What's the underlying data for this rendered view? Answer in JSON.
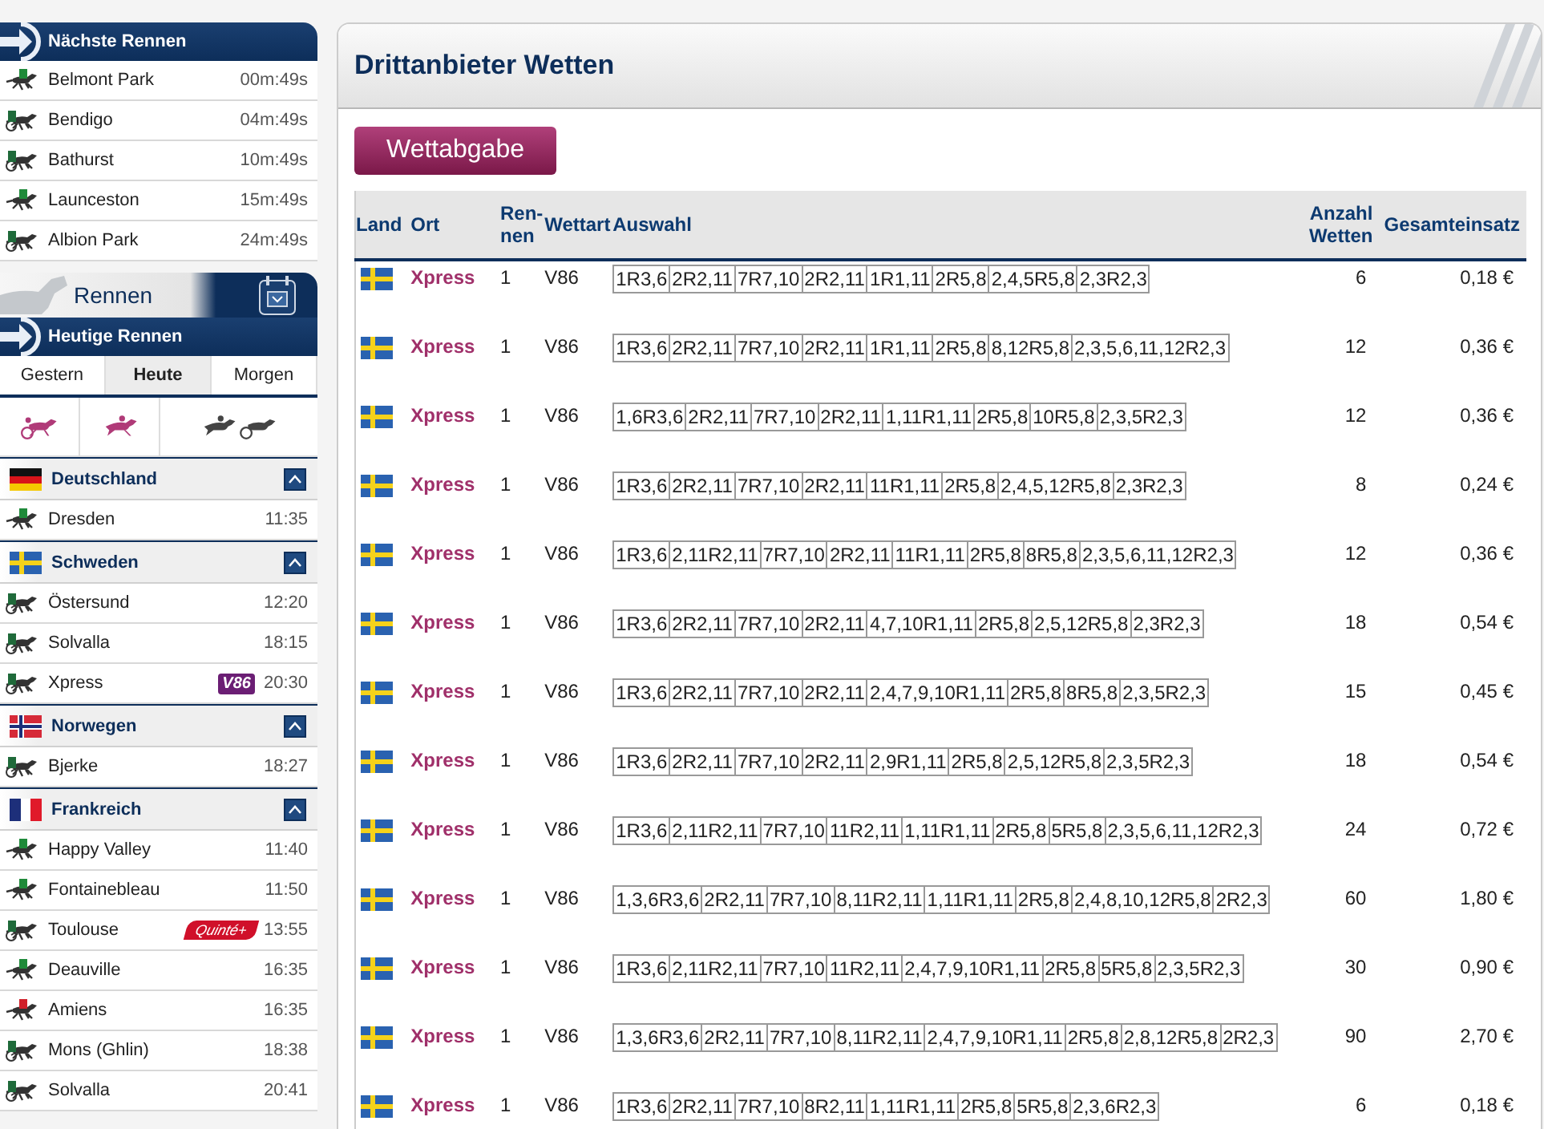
{
  "sidebar": {
    "next_races": {
      "title": "Nächste Rennen",
      "items": [
        {
          "name": "Belmont Park",
          "time": "00m:49s",
          "kind": "gallop",
          "color": "#1f8a3a"
        },
        {
          "name": "Bendigo",
          "time": "04m:49s",
          "kind": "trot",
          "color": "#1f6a3a"
        },
        {
          "name": "Bathurst",
          "time": "10m:49s",
          "kind": "trot",
          "color": "#1f6a3a"
        },
        {
          "name": "Launceston",
          "time": "15m:49s",
          "kind": "gallop",
          "color": "#1f8a3a"
        },
        {
          "name": "Albion Park",
          "time": "24m:49s",
          "kind": "trot",
          "color": "#1f6a3a"
        }
      ]
    },
    "races_header": "Rennen",
    "today": {
      "title": "Heutige Rennen",
      "tabs": [
        {
          "label": "Gestern",
          "selected": false
        },
        {
          "label": "Heute",
          "selected": true
        },
        {
          "label": "Morgen",
          "selected": false
        }
      ],
      "countries": [
        {
          "name": "Deutschland",
          "kind": "de",
          "expanded": true,
          "races": [
            {
              "name": "Dresden",
              "time": "11:35",
              "kind": "gallop",
              "color": "#1f8a3a"
            }
          ]
        },
        {
          "name": "Schweden",
          "kind": "se",
          "expanded": true,
          "races": [
            {
              "name": "Östersund",
              "time": "12:20",
              "kind": "trot",
              "color": "#1f6a3a"
            },
            {
              "name": "Solvalla",
              "time": "18:15",
              "kind": "trot",
              "color": "#1f6a3a"
            },
            {
              "name": "Xpress",
              "time": "20:30",
              "kind": "trot",
              "color": "#1f6a3a",
              "badge": {
                "text": "V86",
                "kind": "v86"
              }
            }
          ]
        },
        {
          "name": "Norwegen",
          "kind": "no",
          "expanded": true,
          "races": [
            {
              "name": "Bjerke",
              "time": "18:27",
              "kind": "trot",
              "color": "#1f6a3a"
            }
          ]
        },
        {
          "name": "Frankreich",
          "kind": "fr",
          "expanded": true,
          "races": [
            {
              "name": "Happy Valley",
              "time": "11:40",
              "kind": "gallop",
              "color": "#1f8a3a"
            },
            {
              "name": "Fontainebleau",
              "time": "11:50",
              "kind": "gallop",
              "color": "#1f8a3a"
            },
            {
              "name": "Toulouse",
              "time": "13:55",
              "kind": "trot",
              "color": "#1f6a3a",
              "badge": {
                "text": "Quinté+",
                "kind": "quinte"
              }
            },
            {
              "name": "Deauville",
              "time": "16:35",
              "kind": "gallop",
              "color": "#1f8a3a"
            },
            {
              "name": "Amiens",
              "time": "16:35",
              "kind": "gallop",
              "color": "#d0202a"
            },
            {
              "name": "Mons (Ghlin)",
              "time": "18:38",
              "kind": "trot",
              "color": "#1f6a3a"
            },
            {
              "name": "Solvalla",
              "time": "20:41",
              "kind": "trot",
              "color": "#1f6a3a"
            }
          ]
        }
      ]
    }
  },
  "main": {
    "title": "Drittanbieter Wetten",
    "submit_button": "Wettabgabe",
    "table": {
      "columns": [
        "Land",
        "Ort",
        "Ren-\nnen",
        "Wettart",
        "Auswahl",
        "Anzahl\nWetten",
        "Gesamteinsatz"
      ],
      "rows": [
        {
          "kind": "se",
          "ort": "Xpress",
          "rennen": "1",
          "wettart": "V86",
          "auswahl": [
            "1R3,6",
            "2R2,11",
            "7R7,10",
            "2R2,11",
            "1R1,11",
            "2R5,8",
            "2,4,5R5,8",
            "2,3R2,3"
          ],
          "anzahl": "6",
          "einsatz": "0,18 €"
        },
        {
          "kind": "se",
          "ort": "Xpress",
          "rennen": "1",
          "wettart": "V86",
          "auswahl": [
            "1R3,6",
            "2R2,11",
            "7R7,10",
            "2R2,11",
            "1R1,11",
            "2R5,8",
            "8,12R5,8",
            "2,3,5,6,11,12R2,3"
          ],
          "anzahl": "12",
          "einsatz": "0,36 €"
        },
        {
          "kind": "se",
          "ort": "Xpress",
          "rennen": "1",
          "wettart": "V86",
          "auswahl": [
            "1,6R3,6",
            "2R2,11",
            "7R7,10",
            "2R2,11",
            "1,11R1,11",
            "2R5,8",
            "10R5,8",
            "2,3,5R2,3"
          ],
          "anzahl": "12",
          "einsatz": "0,36 €"
        },
        {
          "kind": "se",
          "ort": "Xpress",
          "rennen": "1",
          "wettart": "V86",
          "auswahl": [
            "1R3,6",
            "2R2,11",
            "7R7,10",
            "2R2,11",
            "11R1,11",
            "2R5,8",
            "2,4,5,12R5,8",
            "2,3R2,3"
          ],
          "anzahl": "8",
          "einsatz": "0,24 €"
        },
        {
          "kind": "se",
          "ort": "Xpress",
          "rennen": "1",
          "wettart": "V86",
          "auswahl": [
            "1R3,6",
            "2,11R2,11",
            "7R7,10",
            "2R2,11",
            "11R1,11",
            "2R5,8",
            "8R5,8",
            "2,3,5,6,11,12R2,3"
          ],
          "anzahl": "12",
          "einsatz": "0,36 €"
        },
        {
          "kind": "se",
          "ort": "Xpress",
          "rennen": "1",
          "wettart": "V86",
          "auswahl": [
            "1R3,6",
            "2R2,11",
            "7R7,10",
            "2R2,11",
            "4,7,10R1,11",
            "2R5,8",
            "2,5,12R5,8",
            "2,3R2,3"
          ],
          "anzahl": "18",
          "einsatz": "0,54 €"
        },
        {
          "kind": "se",
          "ort": "Xpress",
          "rennen": "1",
          "wettart": "V86",
          "auswahl": [
            "1R3,6",
            "2R2,11",
            "7R7,10",
            "2R2,11",
            "2,4,7,9,10R1,11",
            "2R5,8",
            "8R5,8",
            "2,3,5R2,3"
          ],
          "anzahl": "15",
          "einsatz": "0,45 €"
        },
        {
          "kind": "se",
          "ort": "Xpress",
          "rennen": "1",
          "wettart": "V86",
          "auswahl": [
            "1R3,6",
            "2R2,11",
            "7R7,10",
            "2R2,11",
            "2,9R1,11",
            "2R5,8",
            "2,5,12R5,8",
            "2,3,5R2,3"
          ],
          "anzahl": "18",
          "einsatz": "0,54 €"
        },
        {
          "kind": "se",
          "ort": "Xpress",
          "rennen": "1",
          "wettart": "V86",
          "auswahl": [
            "1R3,6",
            "2,11R2,11",
            "7R7,10",
            "11R2,11",
            "1,11R1,11",
            "2R5,8",
            "5R5,8",
            "2,3,5,6,11,12R2,3"
          ],
          "anzahl": "24",
          "einsatz": "0,72 €"
        },
        {
          "kind": "se",
          "ort": "Xpress",
          "rennen": "1",
          "wettart": "V86",
          "auswahl": [
            "1,3,6R3,6",
            "2R2,11",
            "7R7,10",
            "8,11R2,11",
            "1,11R1,11",
            "2R5,8",
            "2,4,8,10,12R5,8",
            "2R2,3"
          ],
          "anzahl": "60",
          "einsatz": "1,80 €"
        },
        {
          "kind": "se",
          "ort": "Xpress",
          "rennen": "1",
          "wettart": "V86",
          "auswahl": [
            "1R3,6",
            "2,11R2,11",
            "7R7,10",
            "11R2,11",
            "2,4,7,9,10R1,11",
            "2R5,8",
            "5R5,8",
            "2,3,5R2,3"
          ],
          "anzahl": "30",
          "einsatz": "0,90 €"
        },
        {
          "kind": "se",
          "ort": "Xpress",
          "rennen": "1",
          "wettart": "V86",
          "auswahl": [
            "1,3,6R3,6",
            "2R2,11",
            "7R7,10",
            "8,11R2,11",
            "2,4,7,9,10R1,11",
            "2R5,8",
            "2,8,12R5,8",
            "2R2,3"
          ],
          "anzahl": "90",
          "einsatz": "2,70 €"
        },
        {
          "kind": "se",
          "ort": "Xpress",
          "rennen": "1",
          "wettart": "V86",
          "auswahl": [
            "1R3,6",
            "2R2,11",
            "7R7,10",
            "8R2,11",
            "1,11R1,11",
            "2R5,8",
            "5R5,8",
            "2,3,6R2,3"
          ],
          "anzahl": "6",
          "einsatz": "0,18 €"
        }
      ]
    }
  }
}
